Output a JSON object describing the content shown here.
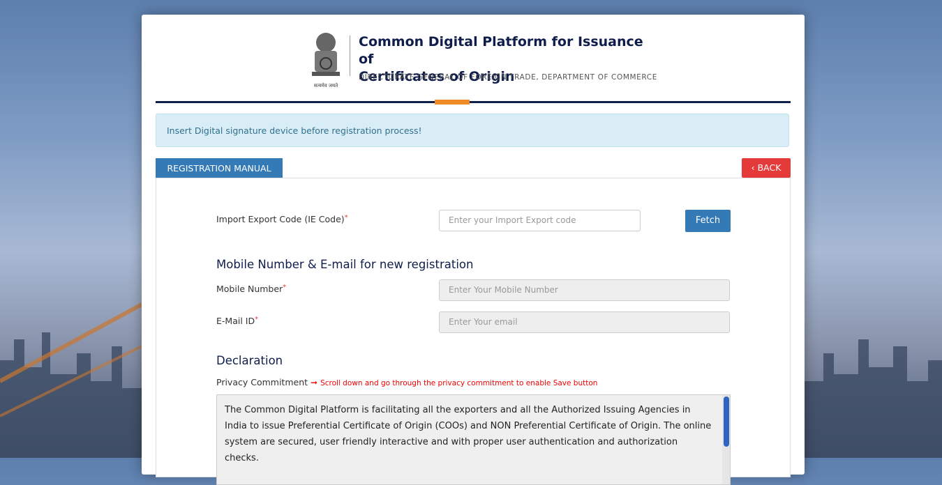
{
  "header": {
    "title_line1": "Common Digital Platform for Issuance of",
    "title_line2": "Certificates of Origin",
    "subtitle": "DIRECTORATE GENERAL OF FOREIGN TRADE, DEPARTMENT OF COMMERCE",
    "emblem_caption": "सत्यमेव जयते"
  },
  "alert": {
    "message": "Insert Digital signature device before registration process!"
  },
  "tabs": {
    "manual_label": "REGISTRATION MANUAL",
    "back_label": "BACK",
    "back_icon": "chevron-left-icon"
  },
  "form": {
    "iec_label": "Import Export Code (IE Code)",
    "iec_placeholder": "Enter your Import Export code",
    "fetch_label": "Fetch",
    "mobile_section_title": "Mobile Number & E-mail for new registration",
    "mobile_label": "Mobile Number",
    "mobile_placeholder": "Enter Your Mobile Number",
    "email_label": "E-Mail ID",
    "email_placeholder": "Enter Your email",
    "required_mark": "*"
  },
  "declaration": {
    "title": "Declaration",
    "privacy_label": "Privacy Commitment",
    "privacy_arrow": "➞",
    "privacy_hint": "Scroll down and go through the privacy commitment to enable Save button",
    "privacy_text": "The Common Digital Platform is facilitating all the exporters and all the Authorized Issuing Agencies in India to issue Preferential Certificate of Origin (COOs) and NON Preferential Certificate of Origin. The online system are secured, user friendly interactive and with proper user authentication and authorization checks."
  },
  "colors": {
    "navy": "#0f1d4b",
    "accent_orange": "#f08a24",
    "primary_blue": "#337ab7",
    "danger_red": "#e43a3a",
    "info_bg": "#d9edf6"
  }
}
